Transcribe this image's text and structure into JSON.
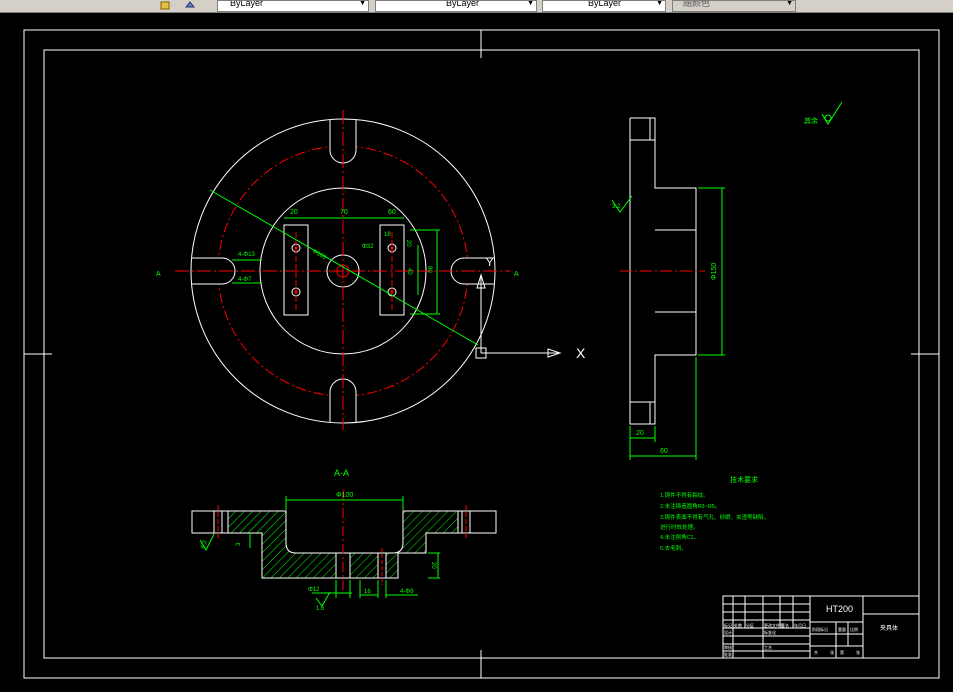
{
  "toolbar": {
    "linetype_combo": "ByLayer",
    "lineweight_combo": "ByLayer",
    "color_combo": "ByLayer",
    "plotstyle_combo": "随颜色"
  },
  "colors": {
    "background": "#000000",
    "outline": "#ffffff",
    "centerline": "#ff0000",
    "dimension": "#00ff00",
    "hatch": "#00ff00",
    "text": "#ffff00"
  },
  "drawing": {
    "plan_dims": {
      "d20": "20",
      "d70": "70",
      "d60": "60",
      "hole1": "4-Φ13",
      "hole2": "4-Φ7",
      "d_big": "Φ180",
      "d_center": "Φ32",
      "d18": "18",
      "d20v": "20",
      "d40": "40",
      "d80": "80",
      "cut_left": "A",
      "cut_right": "A"
    },
    "section_title": "A-A",
    "section_dims": {
      "dia_top": "Φ100",
      "rough_left": "6.3",
      "d3": "3",
      "d20": "20",
      "dia_bottom": "Φ12",
      "rough_bottom": "1.6",
      "d16": "16",
      "holes": "4-Φ8"
    },
    "side_dims": {
      "rough": "3.2",
      "d_vert": "Φ150",
      "d20": "20",
      "d60": "60"
    },
    "roughness_note": "其余",
    "axis_label": "X",
    "axis_label_y": "Y",
    "tech_req_title": "技术要求",
    "tech_req_items": [
      "1.铸件不得有裂纹。",
      "2.未注铸造圆角R3~R5。",
      "3.铸件表面不得有气孔、砂眼、夹渣等缺陷，",
      "进行时效处理。",
      "4.未注倒角C1。",
      "5.去毛刺。"
    ],
    "title_block": {
      "material": "HT200",
      "part_name": "夹具体",
      "small_labels": [
        "标记",
        "处数",
        "分区",
        "更改文件号",
        "签名",
        "年月日",
        "设计",
        "标准化",
        "阶段标记",
        "重量",
        "比例",
        "审核",
        "工艺",
        "批准",
        "共",
        "张",
        "第",
        "张"
      ]
    }
  }
}
